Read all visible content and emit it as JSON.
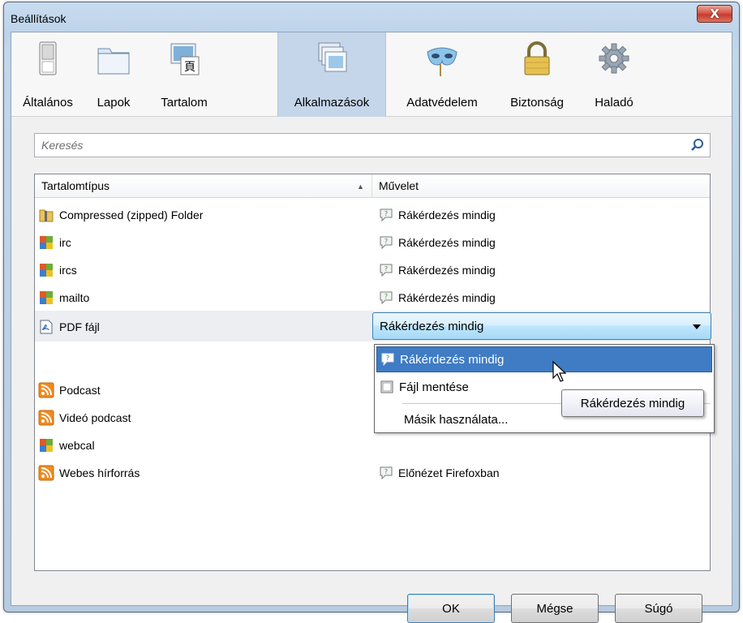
{
  "window": {
    "title": "Beállítások",
    "close_label": "X"
  },
  "toolbar": {
    "items": [
      {
        "label": "Általános"
      },
      {
        "label": "Lapok"
      },
      {
        "label": "Tartalom"
      },
      {
        "label": "Alkalmazások"
      },
      {
        "label": "Adatvédelem"
      },
      {
        "label": "Biztonság"
      },
      {
        "label": "Haladó"
      }
    ],
    "selected": "Alkalmazások"
  },
  "search": {
    "placeholder": "Keresés",
    "value": ""
  },
  "table": {
    "col_type": "Tartalomtípus",
    "col_action": "Művelet",
    "sort_indicator": "▲",
    "rows": [
      {
        "type": "Compressed (zipped) Folder",
        "icon": "zip-folder-icon",
        "action": "Rákérdezés mindig"
      },
      {
        "type": "irc",
        "icon": "app-icon",
        "action": "Rákérdezés mindig"
      },
      {
        "type": "ircs",
        "icon": "app-icon",
        "action": "Rákérdezés mindig"
      },
      {
        "type": "mailto",
        "icon": "app-icon",
        "action": "Rákérdezés mindig"
      },
      {
        "type": "PDF fájl",
        "icon": "pdf-icon",
        "action": "Rákérdezés mindig"
      },
      {
        "type": "Podcast",
        "icon": "rss-icon",
        "action": ""
      },
      {
        "type": "Videó podcast",
        "icon": "rss-icon",
        "action": ""
      },
      {
        "type": "webcal",
        "icon": "app-icon",
        "action": ""
      },
      {
        "type": "Webes hírforrás",
        "icon": "rss-icon",
        "action": "Előnézet Firefoxban"
      }
    ]
  },
  "dropdown": {
    "selected": "Rákérdezés mindig",
    "options": [
      "Rákérdezés mindig",
      "Fájl mentése",
      "Másik használata..."
    ],
    "highlighted": "Rákérdezés mindig"
  },
  "tooltip": {
    "text": "Rákérdezés mindig"
  },
  "buttons": {
    "ok": "OK",
    "cancel": "Mégse",
    "help": "Súgó"
  },
  "colors": {
    "selection": "#3f7cc4",
    "toolbar_selected": "#c5d5ea",
    "close_button": "#c73b2c"
  }
}
